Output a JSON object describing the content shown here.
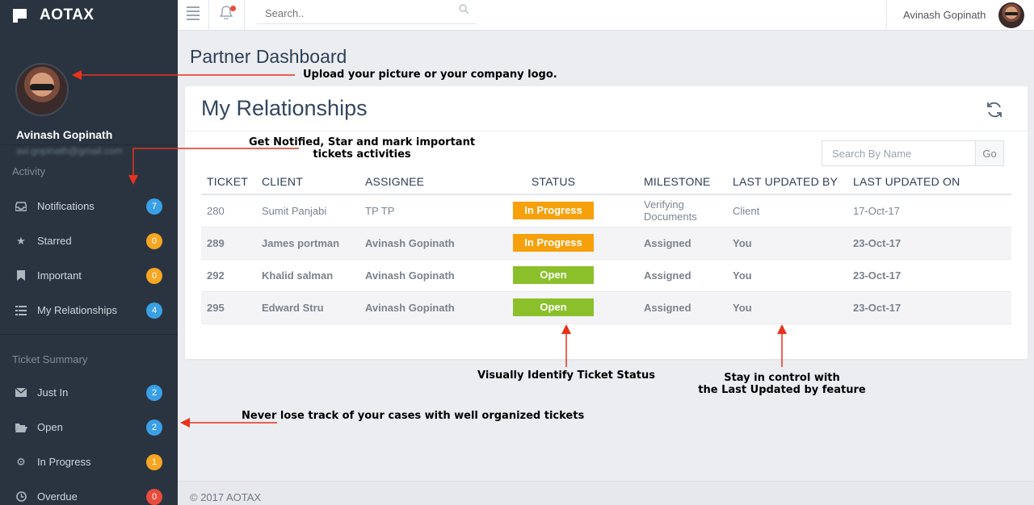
{
  "brand": {
    "name": "AOTAX"
  },
  "profile": {
    "name": "Avinash Gopinath",
    "email": "avi.gopinath@gmail.com"
  },
  "sidebar": {
    "activity_title": "Activity",
    "activity_items": [
      {
        "label": "Notifications",
        "icon": "inbox-icon",
        "count": "7",
        "color": "#3aa0e6"
      },
      {
        "label": "Starred",
        "icon": "star-icon",
        "count": "0",
        "color": "#f5a623"
      },
      {
        "label": "Important",
        "icon": "bookmark-icon",
        "count": "0",
        "color": "#f5a623"
      },
      {
        "label": "My Relationships",
        "icon": "list-icon",
        "count": "4",
        "color": "#3aa0e6"
      }
    ],
    "summary_title": "Ticket Summary",
    "summary_items": [
      {
        "label": "Just In",
        "icon": "envelope-icon",
        "count": "2",
        "color": "#3aa0e6"
      },
      {
        "label": "Open",
        "icon": "folder-open-icon",
        "count": "2",
        "color": "#3aa0e6"
      },
      {
        "label": "In Progress",
        "icon": "gears-icon",
        "count": "1",
        "color": "#f5a623"
      },
      {
        "label": "Overdue",
        "icon": "clock-icon",
        "count": "0",
        "color": "#e74c3c"
      }
    ]
  },
  "topbar": {
    "search_placeholder": "Search..",
    "user_name": "Avinash Gopinath"
  },
  "page": {
    "title": "Partner Dashboard"
  },
  "card": {
    "title": "My Relationships",
    "search_placeholder": "Search By Name",
    "go_label": "Go"
  },
  "table": {
    "headers": [
      "TICKET",
      "CLIENT",
      "ASSIGNEE",
      "STATUS",
      "MILESTONE",
      "LAST UPDATED BY",
      "LAST UPDATED ON"
    ],
    "rows": [
      {
        "ticket": "280",
        "client": "Sumit Panjabi",
        "assignee": "TP TP",
        "status": "In Progress",
        "milestone": "Verifying Documents",
        "updated_by": "Client",
        "updated_on": "17-Oct-17"
      },
      {
        "ticket": "289",
        "client": "James portman",
        "assignee": "Avinash Gopinath",
        "status": "In Progress",
        "milestone": "Assigned",
        "updated_by": "You",
        "updated_on": "23-Oct-17"
      },
      {
        "ticket": "292",
        "client": "Khalid salman",
        "assignee": "Avinash Gopinath",
        "status": "Open",
        "milestone": "Assigned",
        "updated_by": "You",
        "updated_on": "23-Oct-17"
      },
      {
        "ticket": "295",
        "client": "Edward Stru",
        "assignee": "Avinash Gopinath",
        "status": "Open",
        "milestone": "Assigned",
        "updated_by": "You",
        "updated_on": "23-Oct-17"
      }
    ],
    "status_colors": {
      "In Progress": "#f6a00c",
      "Open": "#8bc02b"
    }
  },
  "annotations": {
    "upload": "Upload your picture or your company logo.",
    "notified_line1": "Get Notified, Star and mark important",
    "notified_line2": "tickets activities",
    "visual_status": "Visually Identify Ticket Status",
    "control_line1": "Stay in control with",
    "control_line2": "the Last Updated by feature",
    "never_lose": "Never lose track of your cases with well organized tickets",
    "arrow_color": "#e8321c"
  },
  "footer": {
    "text": "© 2017 AOTAX"
  }
}
